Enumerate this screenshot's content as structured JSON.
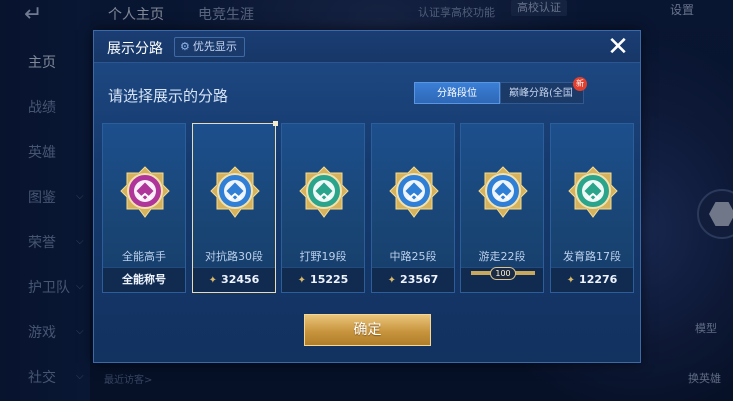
{
  "top_tabs": [
    "个人主页",
    "电竞生涯"
  ],
  "top_right": {
    "verify_text": "认证享高校功能",
    "campus_label": "高校认证",
    "settings_label": "设置"
  },
  "left_nav": [
    "主页",
    "战绩",
    "英雄",
    "图鉴",
    "荣誉",
    "护卫队",
    "游戏",
    "社交"
  ],
  "right_labels": {
    "model": "模型",
    "change_hero": "换英雄"
  },
  "visitors_label": "最近访客>",
  "modal": {
    "title": "展示分路",
    "priority_label": "优先显示",
    "subtitle": "请选择展示的分路",
    "tabs": [
      {
        "label": "分路段位",
        "active": true
      },
      {
        "label": "巅峰分路(全国",
        "active": false,
        "badge": "新"
      }
    ],
    "cards": [
      {
        "name": "全能高手",
        "footer": "全能称号",
        "emblem_color": "#b0359a",
        "selected": false,
        "has_power_icon": false
      },
      {
        "name": "对抗路30段",
        "footer": "32456",
        "emblem_color": "#2f7fd6",
        "selected": true,
        "has_power_icon": true
      },
      {
        "name": "打野19段",
        "footer": "15225",
        "emblem_color": "#2aa58c",
        "selected": false,
        "has_power_icon": true
      },
      {
        "name": "中路25段",
        "footer": "23567",
        "emblem_color": "#2f7fd6",
        "selected": false,
        "has_power_icon": true
      },
      {
        "name": "游走22段",
        "footer": "",
        "emblem_color": "#2f7fd6",
        "selected": false,
        "has_power_icon": false,
        "honor_value": "100"
      },
      {
        "name": "发育路17段",
        "footer": "12276",
        "emblem_color": "#2aa58c",
        "selected": false,
        "has_power_icon": true
      }
    ],
    "confirm_label": "确定"
  },
  "colors": {
    "modal_bg": "#1b447b",
    "gold": "#d8b86a",
    "accent_blue": "#3a7fd6"
  }
}
